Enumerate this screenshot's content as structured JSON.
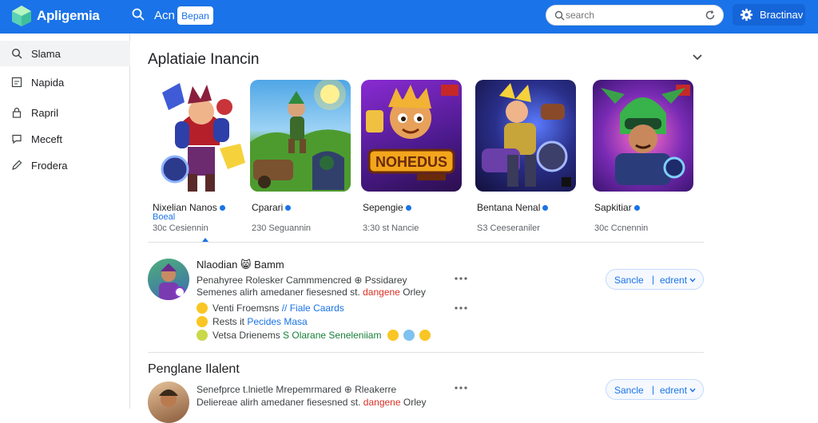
{
  "app": {
    "name": "Apligemia"
  },
  "topbar": {
    "nav_label": "Acn",
    "chip_label": "Bepan",
    "search_placeholder": "search",
    "user_label": "Bractinav"
  },
  "sidebar": {
    "items": [
      {
        "label": "Slama",
        "icon": "search-icon",
        "active": true
      },
      {
        "label": "Napida",
        "icon": "image-icon"
      },
      {
        "label": "Rapril",
        "icon": "lock-icon"
      },
      {
        "label": "Meceft",
        "icon": "chat-icon"
      },
      {
        "label": "Frodera",
        "icon": "pencil-icon"
      }
    ]
  },
  "section": {
    "title": "Aplatiaie Inancin"
  },
  "cards": [
    {
      "name": "Nixelian Nanos",
      "sub": "Boeal",
      "meta": "30c Cesiennin"
    },
    {
      "name": "Cparari",
      "sub": "",
      "meta": "230 Seguannin"
    },
    {
      "name": "Sepengie",
      "sub": "",
      "meta": "3:30 st Nancie"
    },
    {
      "name": "Bentana Nenal",
      "sub": "",
      "meta": "S3 Ceeseraniler"
    },
    {
      "name": "Sapkitiar",
      "sub": "",
      "meta": "30c Ccnennin"
    }
  ],
  "posts": [
    {
      "title": "Nlaodian 😸 Bamm",
      "line1": "Penahyree Rolesker Cammmencred ⊕ Pssidarey",
      "line2a": "Semenes alirh amedaner fiesesned st.",
      "line2b": "dangene",
      "line2c": "Orley",
      "e1a": "Venti Froemsns",
      "e1b": "// Fiale Caards",
      "e2a": "Rests it",
      "e2b": "Pecides Masa",
      "e3a": "Vetsa Drienems",
      "e3b": "S Olarane Seneleniiam",
      "action1": "Sancle",
      "action2": "edrent"
    },
    {
      "line1": "Senefprce t.lnietle Mrepemrmared ⊕ Rleakerre",
      "line2a": "Deliereae alirh amedaner fiesesned st.",
      "line2b": "dangene",
      "line2c": "Orley",
      "action1": "Sancle",
      "action2": "edrent"
    }
  ],
  "second_section": {
    "title": "Penglane Ilalent"
  },
  "colors": {
    "topbar": "#1a73e8",
    "accent": "#1a73e8"
  }
}
